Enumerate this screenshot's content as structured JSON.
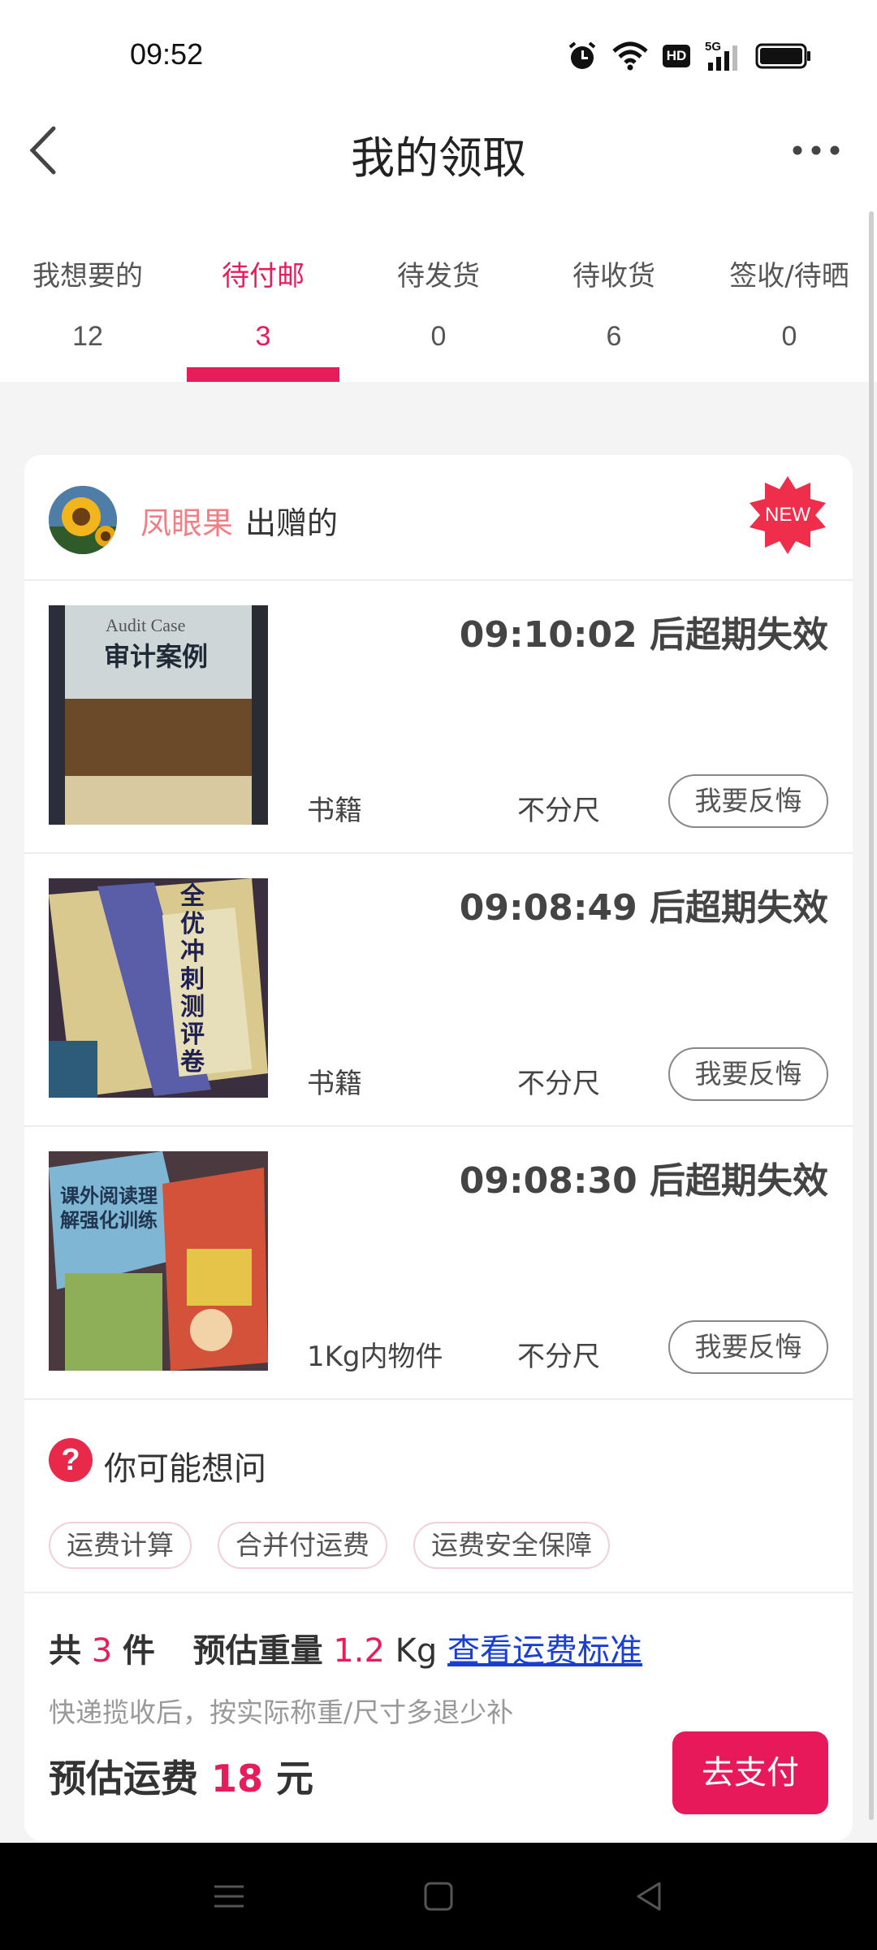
{
  "status": {
    "time": "09:52",
    "network": "5G",
    "hd": "HD"
  },
  "nav": {
    "title": "我的领取"
  },
  "tabs": [
    {
      "label": "我想要的",
      "count": "12"
    },
    {
      "label": "待付邮",
      "count": "3"
    },
    {
      "label": "待发货",
      "count": "0"
    },
    {
      "label": "待收货",
      "count": "6"
    },
    {
      "label": "签收/待晒",
      "count": "0"
    }
  ],
  "active_tab": 1,
  "giver": {
    "name": "凤眼果",
    "suffix": "出赠的",
    "badge": "NEW"
  },
  "items": [
    {
      "countdown": "09:10:02 后超期失效",
      "category": "书籍",
      "size": "不分尺",
      "regret": "我要反悔",
      "thumb_title": "审计案例",
      "thumb_subtitle": "Audit Case"
    },
    {
      "countdown": "09:08:49 后超期失效",
      "category": "书籍",
      "size": "不分尺",
      "regret": "我要反悔",
      "thumb_title": "全优冲刺测评卷"
    },
    {
      "countdown": "09:08:30 后超期失效",
      "category": "1Kg内物件",
      "size": "不分尺",
      "regret": "我要反悔",
      "thumb_title": "课外阅读理解强化训练"
    }
  ],
  "faq": {
    "title": "你可能想问",
    "chips": [
      "运费计算",
      "合并付运费",
      "运费安全保障"
    ]
  },
  "summary": {
    "total_prefix": "共",
    "count": "3",
    "count_unit": "件",
    "weight_label": "预估重量",
    "weight": "1.2",
    "weight_unit": "Kg",
    "standard_link": "查看运费标准",
    "note": "快递揽收后，按实际称重/尺寸多退少补",
    "fee_label": "预估运费",
    "fee": "18",
    "fee_unit": "元",
    "pay_button": "去支付"
  },
  "colors": {
    "accent": "#e61d5a",
    "giver_name": "#f07f85",
    "link": "#1a3fd6"
  }
}
